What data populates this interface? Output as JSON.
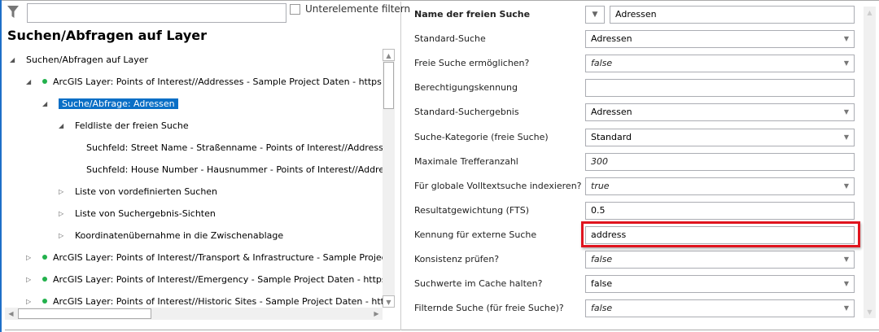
{
  "left": {
    "filter_checkbox_label": "Unterelemente filtern",
    "search_value": "",
    "heading": "Suchen/Abfragen auf Layer",
    "tree": [
      {
        "label": "Suchen/Abfragen auf Layer",
        "level": 0,
        "expanded": true,
        "dot": false
      },
      {
        "label": "ArcGIS Layer: Points of Interest//Addresses - Sample Project Daten - https://W-W",
        "level": 1,
        "expanded": true,
        "dot": true
      },
      {
        "label": "Suche/Abfrage: Adressen",
        "level": 2,
        "expanded": true,
        "dot": false,
        "selected": true
      },
      {
        "label": "Feldliste der freien Suche",
        "level": 3,
        "expanded": true,
        "dot": false
      },
      {
        "label": "Suchfeld: Street Name - Straßenname - Points of Interest//Addresses - S",
        "level": 4,
        "dot": false
      },
      {
        "label": "Suchfeld: House Number - Hausnummer - Points of Interest//Addresses",
        "level": 4,
        "dot": false
      },
      {
        "label": "Liste von vordefinierten Suchen",
        "level": 3,
        "expanded": false,
        "dot": false
      },
      {
        "label": "Liste von Suchergebnis-Sichten",
        "level": 3,
        "expanded": false,
        "dot": false
      },
      {
        "label": "Koordinatenübernahme in die Zwischenablage",
        "level": 3,
        "expanded": false,
        "dot": false
      },
      {
        "label": "ArcGIS Layer: Points of Interest//Transport & Infrastructure - Sample Project Date",
        "level": 1,
        "expanded": false,
        "dot": true
      },
      {
        "label": "ArcGIS Layer: Points of Interest//Emergency - Sample Project Daten - https://W-W",
        "level": 1,
        "expanded": false,
        "dot": true
      },
      {
        "label": "ArcGIS Layer: Points of Interest//Historic Sites - Sample Project Daten - https://W",
        "level": 1,
        "expanded": false,
        "dot": true
      }
    ]
  },
  "right": {
    "rows": [
      {
        "label": "Name der freien Suche",
        "value": "Adressen",
        "bold": true,
        "type": "name"
      },
      {
        "label": "Standard-Suche",
        "value": "Adressen",
        "type": "select"
      },
      {
        "label": "Freie Suche ermöglichen?",
        "value": "false",
        "type": "select",
        "italic": true
      },
      {
        "label": "Berechtigungskennung",
        "value": "",
        "type": "text"
      },
      {
        "label": "Standard-Suchergebnis",
        "value": "Adressen",
        "type": "select"
      },
      {
        "label": "Suche-Kategorie (freie Suche)",
        "value": "Standard",
        "type": "select"
      },
      {
        "label": "Maximale Trefferanzahl",
        "value": "300",
        "type": "text",
        "italic": true
      },
      {
        "label": "Für globale Volltextsuche indexieren?",
        "value": "true",
        "type": "select",
        "italic": true
      },
      {
        "label": "Resultatgewichtung (FTS)",
        "value": "0.5",
        "type": "text"
      },
      {
        "label": "Kennung für externe Suche",
        "value": "address",
        "type": "text",
        "highlighted": true
      },
      {
        "label": "Konsistenz prüfen?",
        "value": "false",
        "type": "select",
        "italic": true
      },
      {
        "label": "Suchwerte im Cache halten?",
        "value": "false",
        "type": "select"
      },
      {
        "label": "Filternde Suche (für freie Suche)?",
        "value": "false",
        "type": "select",
        "italic": true
      }
    ]
  },
  "colors": {
    "accent": "#0a6fc6",
    "highlight": "#e0141e",
    "status_dot": "#22b14c"
  }
}
